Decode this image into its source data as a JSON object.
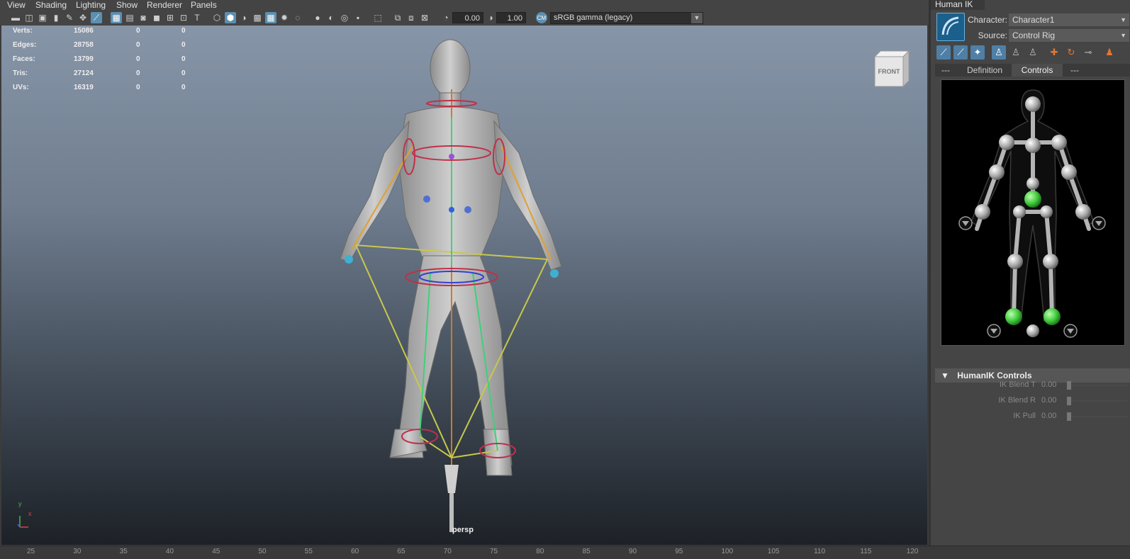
{
  "menu": [
    "View",
    "Shading",
    "Lighting",
    "Show",
    "Renderer",
    "Panels"
  ],
  "toolbar": {
    "exposure": "0.00",
    "gamma": "1.00",
    "colorspace": "sRGB gamma (legacy)",
    "icons": [
      "camera-icon",
      "camera-attributes-icon",
      "bookmark-icon",
      "image-plane-icon",
      "grease-pencil-icon",
      "xray-icon",
      "manipulator-icon",
      "grid-icon",
      "film-gate-icon",
      "resolution-gate-icon",
      "gate-mask-icon",
      "field-chart-icon",
      "safe-action-icon",
      "safe-title-icon",
      "wireframe-icon",
      "smooth-shade-icon",
      "shaded-wireframe-icon",
      "texture-icon",
      "lights-icon",
      "shadows-icon",
      "ambient-occlusion-icon",
      "motion-blur-icon",
      "antialiasing-icon",
      "depth-of-field-icon",
      "isolate-select-icon",
      "xray-joints-icon",
      "xray-active-icon",
      "exposure-icon",
      "gamma-icon",
      "color-management-icon"
    ]
  },
  "hud": {
    "rows": [
      {
        "label": "Verts:",
        "a": "15086",
        "b": "0",
        "c": "0"
      },
      {
        "label": "Edges:",
        "a": "28758",
        "b": "0",
        "c": "0"
      },
      {
        "label": "Faces:",
        "a": "13799",
        "b": "0",
        "c": "0"
      },
      {
        "label": "Tris:",
        "a": "27124",
        "b": "0",
        "c": "0"
      },
      {
        "label": "UVs:",
        "a": "16319",
        "b": "0",
        "c": "0"
      }
    ]
  },
  "viewcube": "FRONT",
  "camera_label": "persp",
  "axis": {
    "x": "x",
    "y": "y"
  },
  "timeline": [
    "25",
    "30",
    "35",
    "40",
    "45",
    "50",
    "55",
    "60",
    "65",
    "70",
    "75",
    "80",
    "85",
    "90",
    "95",
    "100",
    "105",
    "110",
    "115",
    "120"
  ],
  "hik": {
    "tab": "Human IK",
    "character_label": "Character:",
    "character_value": "Character1",
    "source_label": "Source:",
    "source_value": "Control Rig",
    "tabs": [
      "---",
      "Definition",
      "Controls",
      "---"
    ],
    "active_tab": "Controls",
    "section": "HumanIK Controls",
    "controls": [
      {
        "label": "IK Blend T",
        "value": "0.00"
      },
      {
        "label": "IK Blend R",
        "value": "0.00"
      },
      {
        "label": "IK Pull",
        "value": "0.00"
      }
    ],
    "accent": "#45c83c"
  }
}
